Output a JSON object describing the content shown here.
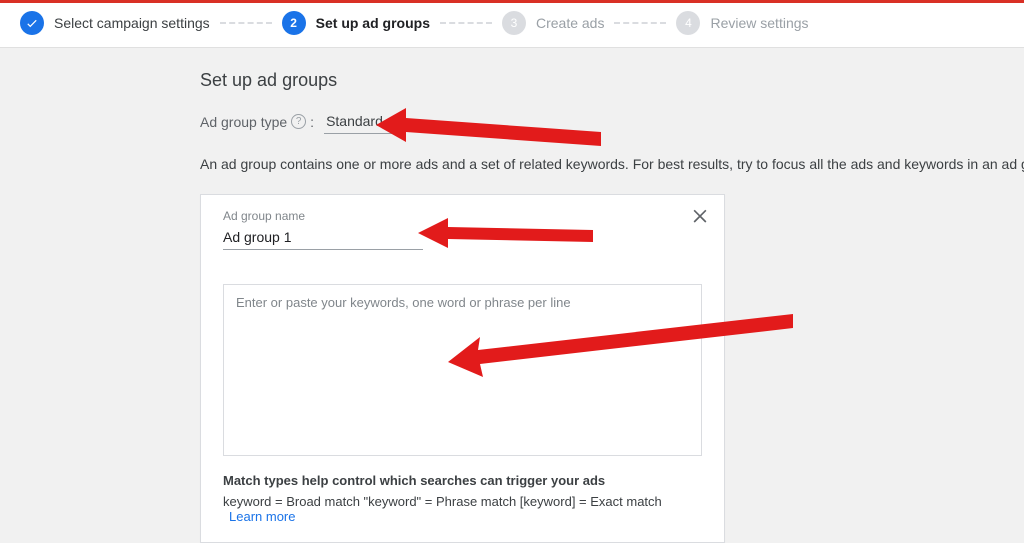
{
  "stepper": {
    "steps": [
      {
        "label": "Select campaign settings",
        "state": "done"
      },
      {
        "label": "Set up ad groups",
        "state": "active",
        "num": "2"
      },
      {
        "label": "Create ads",
        "state": "inactive",
        "num": "3"
      },
      {
        "label": "Review settings",
        "state": "inactive",
        "num": "4"
      }
    ]
  },
  "page": {
    "title": "Set up ad groups",
    "type_label": "Ad group type",
    "type_value": "Standard",
    "description": "An ad group contains one or more ads and a set of related keywords. For best results, try to focus all the ads and keywords in an ad group on one product or"
  },
  "card": {
    "name_label": "Ad group name",
    "name_value": "Ad group 1",
    "kw_placeholder": "Enter or paste your keywords, one word or phrase per line",
    "match_title": "Match types help control which searches can trigger your ads",
    "match_line": "keyword = Broad match   \"keyword\" = Phrase match   [keyword] = Exact match",
    "learn_more": "Learn more"
  }
}
